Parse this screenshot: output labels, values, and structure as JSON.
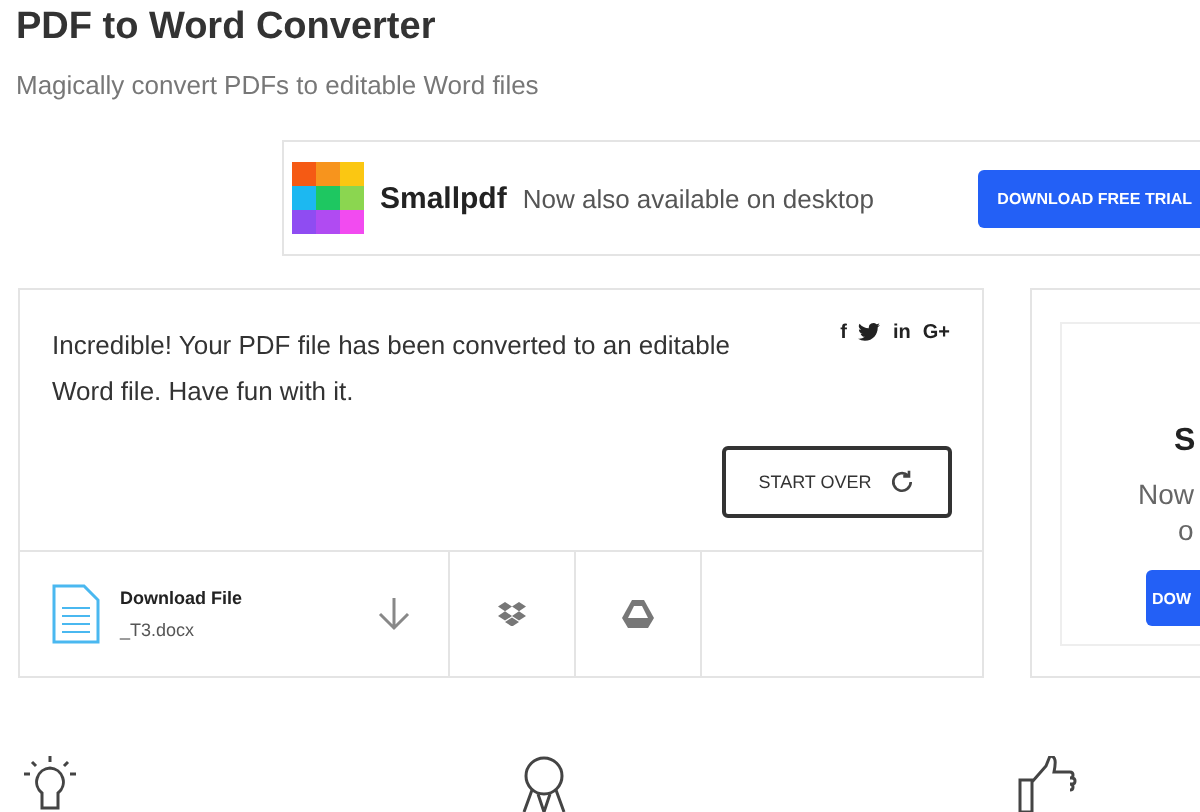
{
  "header": {
    "title": "PDF to Word Converter",
    "subtitle": "Magically convert PDFs to editable Word files"
  },
  "banner": {
    "brand": "Smallpdf",
    "tagline": "Now also available on desktop",
    "button": "DOWNLOAD FREE TRIAL"
  },
  "result": {
    "message": "Incredible! Your PDF file has been converted to an editable Word file. Have fun with it.",
    "share": [
      {
        "kind": "text",
        "label": "f"
      },
      {
        "kind": "bird"
      },
      {
        "kind": "text",
        "label": "in"
      },
      {
        "kind": "text",
        "label": "G+"
      }
    ],
    "start_over": "START OVER"
  },
  "file": {
    "label": "Download File",
    "name": "_T3.docx"
  },
  "side_ad": {
    "brand": "S",
    "line_1": "Now",
    "line_2": "o",
    "button": "DOW"
  }
}
